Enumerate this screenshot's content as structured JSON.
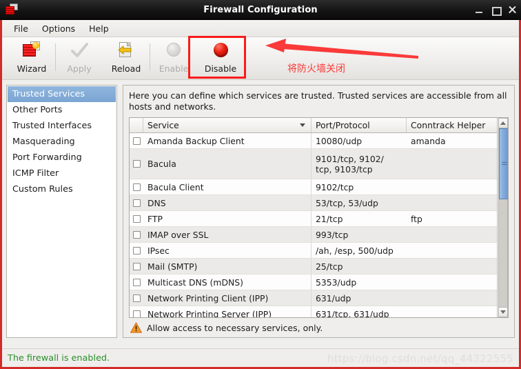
{
  "window": {
    "title": "Firewall Configuration",
    "icon": "firewall-icon",
    "controls": {
      "minimize": "minimize",
      "maximize": "maximize",
      "close": "close"
    }
  },
  "menubar": {
    "items": [
      "File",
      "Options",
      "Help"
    ]
  },
  "toolbar": {
    "buttons": [
      {
        "label": "Wizard",
        "icon": "wizard-icon",
        "enabled": true
      },
      {
        "label": "Apply",
        "icon": "check-icon",
        "enabled": false
      },
      {
        "label": "Reload",
        "icon": "reload-icon",
        "enabled": true
      },
      {
        "label": "Enable",
        "icon": "grey-sphere-icon",
        "enabled": false
      },
      {
        "label": "Disable",
        "icon": "red-sphere-icon",
        "enabled": true
      }
    ]
  },
  "annotation": {
    "text": "将防火墙关闭",
    "color": "#fb3a3a",
    "highlight_target": "Disable"
  },
  "sidebar": {
    "items": [
      {
        "label": "Trusted Services",
        "selected": true
      },
      {
        "label": "Other Ports",
        "selected": false
      },
      {
        "label": "Trusted Interfaces",
        "selected": false
      },
      {
        "label": "Masquerading",
        "selected": false
      },
      {
        "label": "Port Forwarding",
        "selected": false
      },
      {
        "label": "ICMP Filter",
        "selected": false
      },
      {
        "label": "Custom Rules",
        "selected": false
      }
    ]
  },
  "panel": {
    "description": "Here you can define which services are trusted. Trusted services are accessible from all hosts and networks.",
    "table": {
      "columns": [
        "Service",
        "Port/Protocol",
        "Conntrack Helper"
      ],
      "sort_column": "Service",
      "rows": [
        {
          "checked": false,
          "service": "Amanda Backup Client",
          "port": "10080/udp",
          "helper": "amanda"
        },
        {
          "checked": false,
          "service": "Bacula",
          "port": "9101/tcp, 9102/\ntcp, 9103/tcp",
          "helper": ""
        },
        {
          "checked": false,
          "service": "Bacula Client",
          "port": "9102/tcp",
          "helper": ""
        },
        {
          "checked": false,
          "service": "DNS",
          "port": "53/tcp, 53/udp",
          "helper": ""
        },
        {
          "checked": false,
          "service": "FTP",
          "port": "21/tcp",
          "helper": "ftp"
        },
        {
          "checked": false,
          "service": "IMAP over SSL",
          "port": "993/tcp",
          "helper": ""
        },
        {
          "checked": false,
          "service": "IPsec",
          "port": "/ah, /esp, 500/udp",
          "helper": ""
        },
        {
          "checked": false,
          "service": "Mail (SMTP)",
          "port": "25/tcp",
          "helper": ""
        },
        {
          "checked": false,
          "service": "Multicast DNS (mDNS)",
          "port": "5353/udp",
          "helper": ""
        },
        {
          "checked": false,
          "service": "Network Printing Client (IPP)",
          "port": "631/udp",
          "helper": ""
        },
        {
          "checked": false,
          "service": "Network Printing Server (IPP)",
          "port": "631/tcp, 631/udp",
          "helper": ""
        }
      ]
    },
    "warning": {
      "icon": "warning-triangle-icon",
      "text": "Allow access to necessary services, only."
    }
  },
  "statusbar": {
    "text": "The firewall is enabled.",
    "color": "#2a8f2a"
  },
  "watermark": "https://blog.csdn.net/qq_44322555"
}
